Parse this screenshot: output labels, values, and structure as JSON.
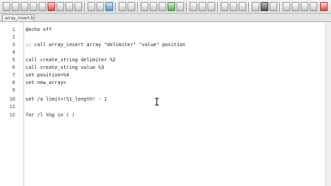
{
  "tab": {
    "label": "array_insert.bat"
  },
  "toolbar": {
    "icons": [
      "new-file",
      "open-file",
      "save-file",
      "save-all",
      "close-file",
      "print",
      "cut",
      "copy",
      "paste",
      "undo",
      "redo",
      "find",
      "replace",
      "goto",
      "bookmark",
      "zoom-in",
      "zoom-out",
      "wrap",
      "indent",
      "macro-record",
      "macro-play",
      "run",
      "settings",
      "help",
      "close"
    ]
  },
  "editor": {
    "lines": [
      {
        "num": "1",
        "text": "@echo off"
      },
      {
        "num": "2",
        "text": ""
      },
      {
        "num": "3",
        "text": ":: call array_insert array \"delimiter\" \"value\" position"
      },
      {
        "num": "4",
        "text": ""
      },
      {
        "num": "5",
        "text": "call create_string delimiter %2"
      },
      {
        "num": "6",
        "text": "call create_string value %3"
      },
      {
        "num": "7",
        "text": "set position=%4"
      },
      {
        "num": "8",
        "text": "set new_array="
      },
      {
        "num": "9",
        "text": ""
      },
      {
        "num": "10",
        "text": "set /a limit=!%1_length! - 1"
      },
      {
        "num": "11",
        "text": ""
      },
      {
        "num": "12",
        "text": "for /l %%g in ( )"
      }
    ]
  }
}
